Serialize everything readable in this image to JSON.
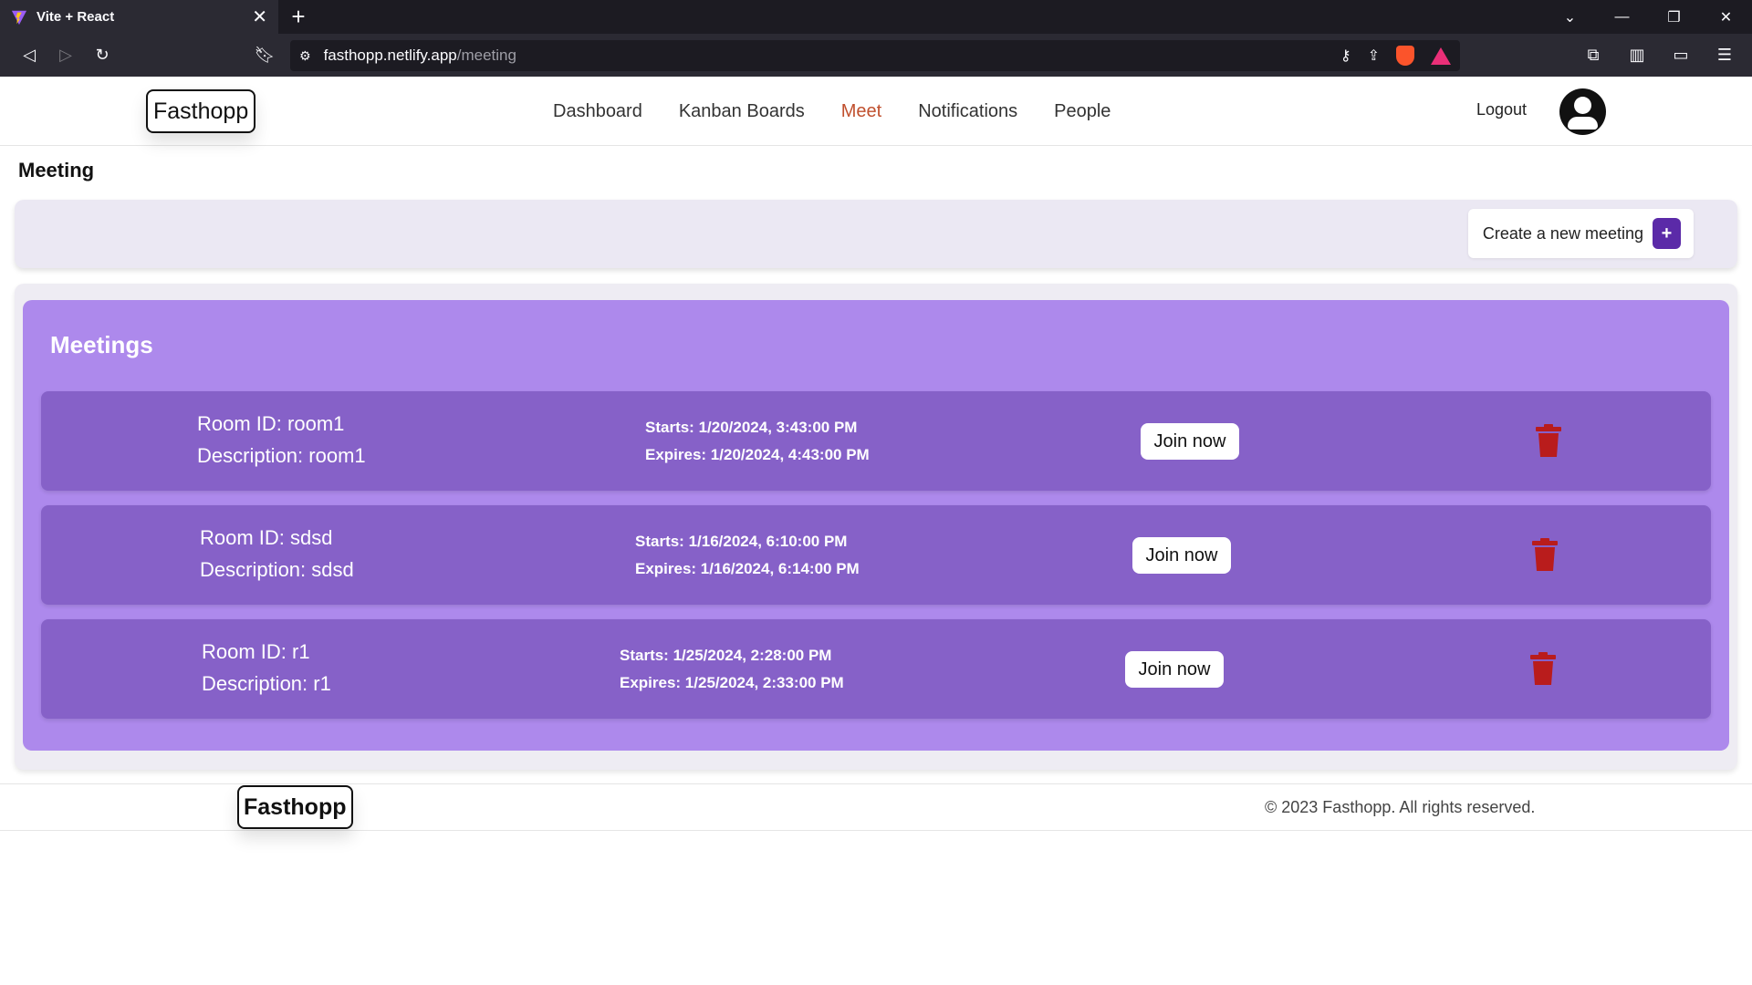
{
  "browser": {
    "tab_title": "Vite + React",
    "tab_close": "✕",
    "new_tab": "+",
    "url_host": "fasthopp.netlify.app",
    "url_path": "/meeting"
  },
  "header": {
    "logo": "Fasthopp",
    "nav": [
      "Dashboard",
      "Kanban Boards",
      "Meet",
      "Notifications",
      "People"
    ],
    "active_nav": "Meet",
    "logout": "Logout"
  },
  "page": {
    "title": "Meeting",
    "create_button": "Create a new meeting",
    "create_icon": "+",
    "meetings_title": "Meetings"
  },
  "meetings": [
    {
      "room_id": "Room ID: room1",
      "description": "Description: room1",
      "starts": "Starts: 1/20/2024, 3:43:00 PM",
      "expires": "Expires: 1/20/2024, 4:43:00 PM",
      "join": "Join now"
    },
    {
      "room_id": "Room ID: sdsd",
      "description": "Description: sdsd",
      "starts": "Starts: 1/16/2024, 6:10:00 PM",
      "expires": "Expires: 1/16/2024, 6:14:00 PM",
      "join": "Join now"
    },
    {
      "room_id": "Room ID: r1",
      "description": "Description: r1",
      "starts": "Starts: 1/25/2024, 2:28:00 PM",
      "expires": "Expires: 1/25/2024, 2:33:00 PM",
      "join": "Join now"
    }
  ],
  "footer": {
    "logo": "Fasthopp",
    "copyright": "© 2023 Fasthopp. All rights reserved."
  },
  "colors": {
    "accent": "#5b2aa8",
    "panel": "#ad89ec",
    "row": "#8661c8",
    "delete": "#b91c1c",
    "active_nav": "#c0502e"
  }
}
